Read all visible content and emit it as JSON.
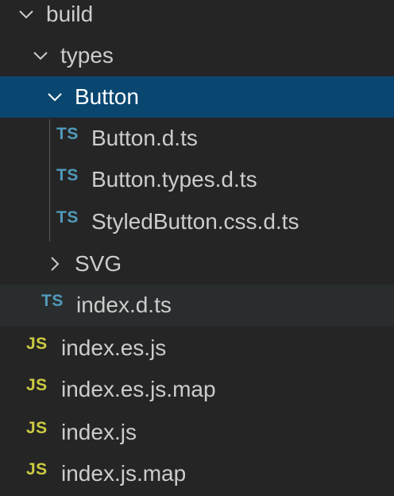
{
  "explorer": {
    "rows": [
      {
        "label": "build",
        "kind": "folder",
        "expanded": true,
        "depth": 0
      },
      {
        "label": "types",
        "kind": "folder",
        "expanded": true,
        "depth": 1
      },
      {
        "label": "Button",
        "kind": "folder",
        "expanded": true,
        "depth": 2,
        "selected": true
      },
      {
        "label": "Button.d.ts",
        "kind": "file",
        "icon": "TS",
        "depth": 3
      },
      {
        "label": "Button.types.d.ts",
        "kind": "file",
        "icon": "TS",
        "depth": 3
      },
      {
        "label": "StyledButton.css.d.ts",
        "kind": "file",
        "icon": "TS",
        "depth": 3
      },
      {
        "label": "SVG",
        "kind": "folder",
        "expanded": false,
        "depth": 2
      },
      {
        "label": "index.d.ts",
        "kind": "file",
        "icon": "TS",
        "depth": 2,
        "hovered": true
      },
      {
        "label": "index.es.js",
        "kind": "file",
        "icon": "JS",
        "depth": 1
      },
      {
        "label": "index.es.js.map",
        "kind": "file",
        "icon": "JS",
        "depth": 1
      },
      {
        "label": "index.js",
        "kind": "file",
        "icon": "JS",
        "depth": 1
      },
      {
        "label": "index.js.map",
        "kind": "file",
        "icon": "JS",
        "depth": 1
      }
    ]
  },
  "colors": {
    "background": "#252526",
    "selected_row": "#094771",
    "hover_row": "#2a2d2e",
    "text": "#cccccc",
    "selected_text": "#ffffff",
    "ts_icon": "#519aba",
    "js_icon": "#cbcb41",
    "indent_guide": "#585858"
  },
  "icons": {
    "expanded": "chevron-down-icon",
    "collapsed": "chevron-right-icon",
    "typescript": "typescript-file-icon",
    "javascript": "javascript-file-icon"
  }
}
